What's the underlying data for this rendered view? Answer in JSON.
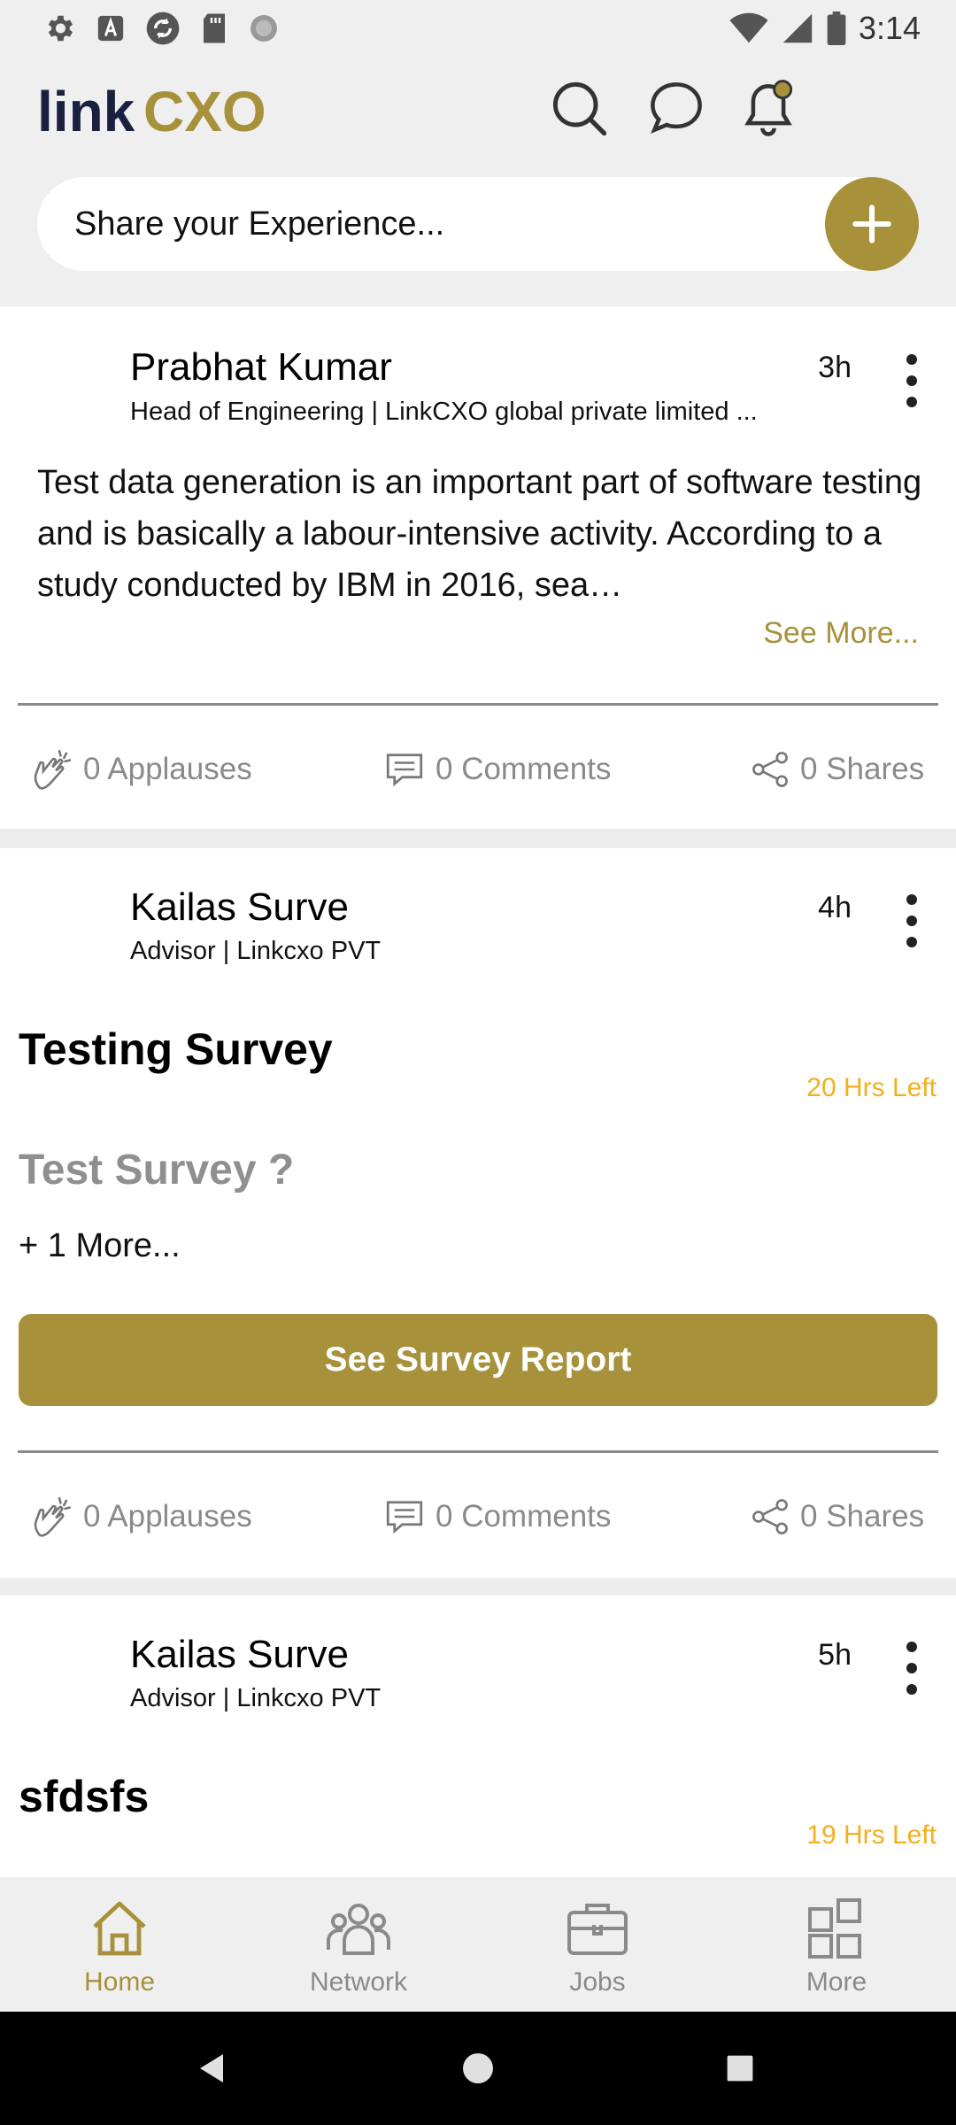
{
  "status_bar": {
    "time": "3:14",
    "left_icons": [
      "settings-icon",
      "text-icon",
      "sync-icon",
      "sd-card-icon",
      "loading-icon"
    ],
    "right_icons": [
      "wifi-icon",
      "signal-icon",
      "battery-icon"
    ]
  },
  "header": {
    "logo_text_main": "link",
    "logo_text_accent": "CXO",
    "icons": [
      "search-icon",
      "chat-icon",
      "bell-icon"
    ],
    "share_placeholder": "Share your Experience...",
    "accent_color": "#a8913b"
  },
  "posts": [
    {
      "author": "Prabhat Kumar",
      "role": "Head of Engineering | LinkCXO global private limited ...",
      "time": "3h",
      "text": "Test data generation is an important part of software testing and is basically a labour-intensive activity. According to a study conducted by IBM in 2016, sea…",
      "see_more": "See More...",
      "applauses": "0 Applauses",
      "comments": "0 Comments",
      "shares": "0 Shares"
    },
    {
      "author": "Kailas Surve",
      "role": "Advisor | Linkcxo PVT",
      "time": "4h",
      "survey_title": "Testing Survey",
      "hrs_left": "20 Hrs Left",
      "question": "Test Survey ?",
      "more": "+ 1 More...",
      "button": "See Survey Report",
      "applauses": "0 Applauses",
      "comments": "0 Comments",
      "shares": "0 Shares"
    },
    {
      "author": "Kailas Surve",
      "role": "Advisor | Linkcxo PVT",
      "time": "5h",
      "survey_title": "sfdsfs",
      "hrs_left": "19 Hrs Left"
    }
  ],
  "bottom_nav": {
    "items": [
      {
        "label": "Home",
        "icon": "home-icon",
        "active": true
      },
      {
        "label": "Network",
        "icon": "network-icon",
        "active": false
      },
      {
        "label": "Jobs",
        "icon": "briefcase-icon",
        "active": false
      },
      {
        "label": "More",
        "icon": "grid-icon",
        "active": false
      }
    ],
    "active_color": "#a8913b",
    "inactive_color": "#8a8a8a"
  },
  "system_nav": [
    "back-icon",
    "home-circle-icon",
    "recents-icon"
  ]
}
